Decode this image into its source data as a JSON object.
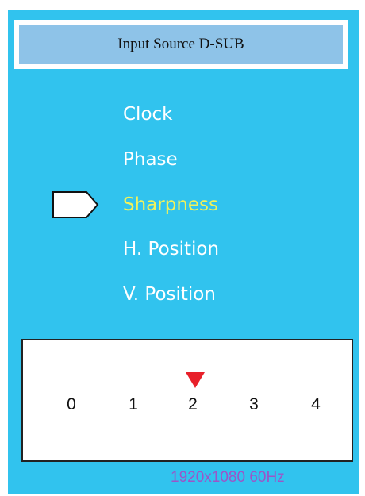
{
  "header": {
    "title": "Input Source D-SUB"
  },
  "menu": {
    "items": [
      {
        "label": "Clock"
      },
      {
        "label": "Phase"
      },
      {
        "label": "Sharpness",
        "selected": true
      },
      {
        "label": "H. Position"
      },
      {
        "label": "V. Position"
      }
    ]
  },
  "sharpness_scale": {
    "labels": [
      "0",
      "1",
      "2",
      "3",
      "4"
    ],
    "current_value": 2
  },
  "status": {
    "resolution": "1920x1080 60Hz"
  },
  "colors": {
    "background": "#31c3ee",
    "header_fill": "#8ec3e8",
    "selected_text": "#f2f25a",
    "indicator": "#e8202a",
    "status_text": "#9b55c8"
  },
  "icons": {
    "selection_pointer": "pointer-arrow-icon",
    "value_indicator": "triangle-down-icon"
  }
}
